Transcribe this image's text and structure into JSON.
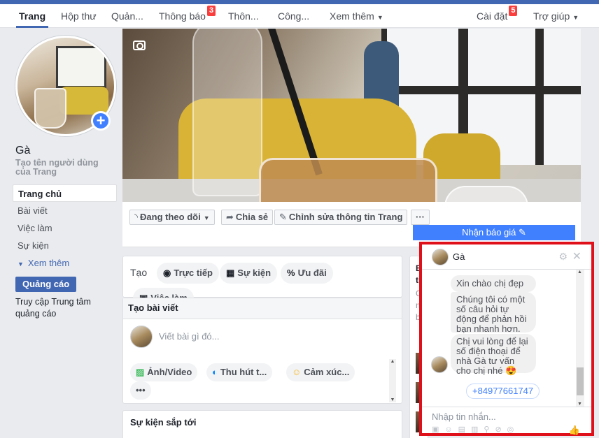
{
  "nav": {
    "tabs": [
      {
        "label": "Trang"
      },
      {
        "label": "Hộp thư"
      },
      {
        "label": "Quản..."
      },
      {
        "label": "Thông báo",
        "badge": "3"
      },
      {
        "label": "Thôn..."
      },
      {
        "label": "Công..."
      },
      {
        "label": "Xem thêm"
      },
      {
        "label": "Cài đặt",
        "badge": "5"
      },
      {
        "label": "Trợ giúp"
      }
    ]
  },
  "sidebar": {
    "page_name": "Gà",
    "create_username": "Tạo tên người dùng của Trang",
    "items": [
      {
        "label": "Trang chủ"
      },
      {
        "label": "Bài viết"
      },
      {
        "label": "Việc làm"
      },
      {
        "label": "Sự kiện"
      },
      {
        "label": "Xem thêm"
      }
    ],
    "ad_button": "Quảng cáo",
    "ad_center": "Truy cập Trung tâm quảng cáo"
  },
  "cover": {
    "actions": [
      {
        "label": "Đang theo dõi",
        "icon": "rss-icon"
      },
      {
        "label": "Chia sẻ",
        "icon": "share-icon"
      },
      {
        "label": "Chỉnh sửa thông tin Trang",
        "icon": "pencil-icon"
      },
      {
        "label": "···"
      }
    ],
    "quote_button": "Nhận báo giá ✎"
  },
  "create": {
    "label": "Tạo",
    "chips": [
      {
        "label": "Trực tiếp",
        "icon": "camera-icon"
      },
      {
        "label": "Sự kiện",
        "icon": "calendar-icon"
      },
      {
        "label": "Ưu đãi",
        "icon": "percent-icon"
      },
      {
        "label": "Việc làm",
        "icon": "briefcase-icon"
      }
    ]
  },
  "post": {
    "header": "Tạo bài viết",
    "placeholder": "Viết bài gì đó...",
    "chips": [
      {
        "label": "Ảnh/Video",
        "icon": "photo-icon"
      },
      {
        "label": "Thu hút t...",
        "icon": "messenger-icon"
      },
      {
        "label": "Cảm xúc...",
        "icon": "smiley-icon"
      },
      {
        "label": "•••"
      }
    ]
  },
  "events": {
    "title": "Sự kiện sắp tới"
  },
  "rightcard": {
    "lines": [
      "Bạ",
      "tiế",
      "Ch",
      "ng",
      "bạ"
    ]
  },
  "chat": {
    "title": "Gà",
    "messages": [
      "Xin chào chị đẹp",
      "Chúng tôi có một số câu hỏi tự động để phản hồi bạn nhanh hơn.",
      "Chị vui lòng để lại số điện thoại để nhà Gà tư vấn cho chị nhé 😍"
    ],
    "phone": "+84977661747",
    "input_placeholder": "Nhập tin nhắn..."
  },
  "colors": {
    "brand": "#4267b2",
    "accent": "#4080ff",
    "badge": "#fa3e3e",
    "highlight": "#e0101a"
  }
}
